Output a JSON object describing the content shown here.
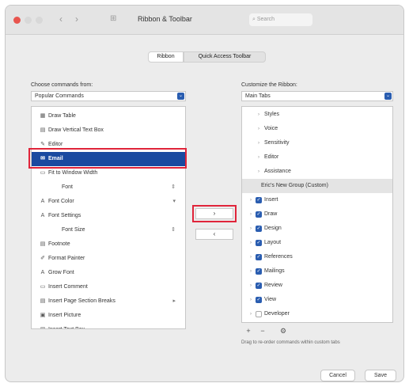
{
  "window": {
    "title": "Ribbon & Toolbar",
    "search_placeholder": "Search"
  },
  "tabs": {
    "ribbon": "Ribbon",
    "qat": "Quick Access Toolbar"
  },
  "left": {
    "label": "Choose commands from:",
    "dropdown_value": "Popular Commands",
    "items": [
      {
        "icon": "table-icon",
        "glyph": "▦",
        "label": "Draw Table",
        "arrow": ""
      },
      {
        "icon": "text-box-icon",
        "glyph": "▤",
        "label": "Draw Vertical Text Box",
        "arrow": ""
      },
      {
        "icon": "editor-icon",
        "glyph": "✎",
        "label": "Editor",
        "arrow": ""
      },
      {
        "icon": "email-icon",
        "glyph": "✉",
        "label": "Email",
        "arrow": "",
        "selected": true
      },
      {
        "icon": "fit-window-icon",
        "glyph": "▭",
        "label": "Fit to Window Width",
        "arrow": ""
      },
      {
        "icon": "",
        "glyph": "",
        "label": "Font",
        "arrow": "⇕"
      },
      {
        "icon": "font-color-icon",
        "glyph": "A",
        "label": "Font Color",
        "arrow": "▾"
      },
      {
        "icon": "font-settings-icon",
        "glyph": "A",
        "label": "Font Settings",
        "arrow": ""
      },
      {
        "icon": "",
        "glyph": "",
        "label": "Font Size",
        "arrow": "⇕"
      },
      {
        "icon": "footnote-icon",
        "glyph": "▤",
        "label": "Footnote",
        "arrow": ""
      },
      {
        "icon": "format-painter-icon",
        "glyph": "✐",
        "label": "Format Painter",
        "arrow": ""
      },
      {
        "icon": "grow-font-icon",
        "glyph": "A",
        "label": "Grow Font",
        "arrow": ""
      },
      {
        "icon": "comment-icon",
        "glyph": "▭",
        "label": "Insert Comment",
        "arrow": ""
      },
      {
        "icon": "page-break-icon",
        "glyph": "▤",
        "label": "Insert Page  Section Breaks",
        "arrow": "▸"
      },
      {
        "icon": "picture-icon",
        "glyph": "▣",
        "label": "Insert Picture",
        "arrow": ""
      },
      {
        "icon": "text-box-icon",
        "glyph": "▤",
        "label": "Insert Text Box",
        "arrow": ""
      }
    ]
  },
  "move": {
    "add": "›",
    "remove": "‹"
  },
  "right": {
    "label": "Customize the Ribbon:",
    "dropdown_value": "Main Tabs",
    "items": [
      {
        "label": "Styles",
        "indent": 2,
        "check": "none",
        "tw": "›"
      },
      {
        "label": "Voice",
        "indent": 2,
        "check": "none",
        "tw": "›"
      },
      {
        "label": "Sensitivity",
        "indent": 2,
        "check": "none",
        "tw": "›"
      },
      {
        "label": "Editor",
        "indent": 2,
        "check": "none",
        "tw": "›"
      },
      {
        "label": "Assistance",
        "indent": 2,
        "check": "none",
        "tw": "›"
      },
      {
        "label": "Eric's New Group (Custom)",
        "indent": 2,
        "check": "none",
        "tw": "",
        "group": true
      },
      {
        "label": "Insert",
        "indent": 1,
        "check": "on",
        "tw": "›"
      },
      {
        "label": "Draw",
        "indent": 1,
        "check": "on",
        "tw": "›"
      },
      {
        "label": "Design",
        "indent": 1,
        "check": "on",
        "tw": "›"
      },
      {
        "label": "Layout",
        "indent": 1,
        "check": "on",
        "tw": "›"
      },
      {
        "label": "References",
        "indent": 1,
        "check": "on",
        "tw": "›"
      },
      {
        "label": "Mailings",
        "indent": 1,
        "check": "on",
        "tw": "›"
      },
      {
        "label": "Review",
        "indent": 1,
        "check": "on",
        "tw": "›"
      },
      {
        "label": "View",
        "indent": 1,
        "check": "on",
        "tw": "›"
      },
      {
        "label": "Developer",
        "indent": 1,
        "check": "off",
        "tw": "›"
      }
    ],
    "add_btn": "+",
    "remove_btn": "−",
    "settings_glyph": "⚙",
    "hint": "Drag to re-order commands within custom tabs"
  },
  "footer": {
    "cancel": "Cancel",
    "save": "Save"
  },
  "colors": {
    "accent": "#1a4aa0",
    "highlight": "#e0243a"
  }
}
